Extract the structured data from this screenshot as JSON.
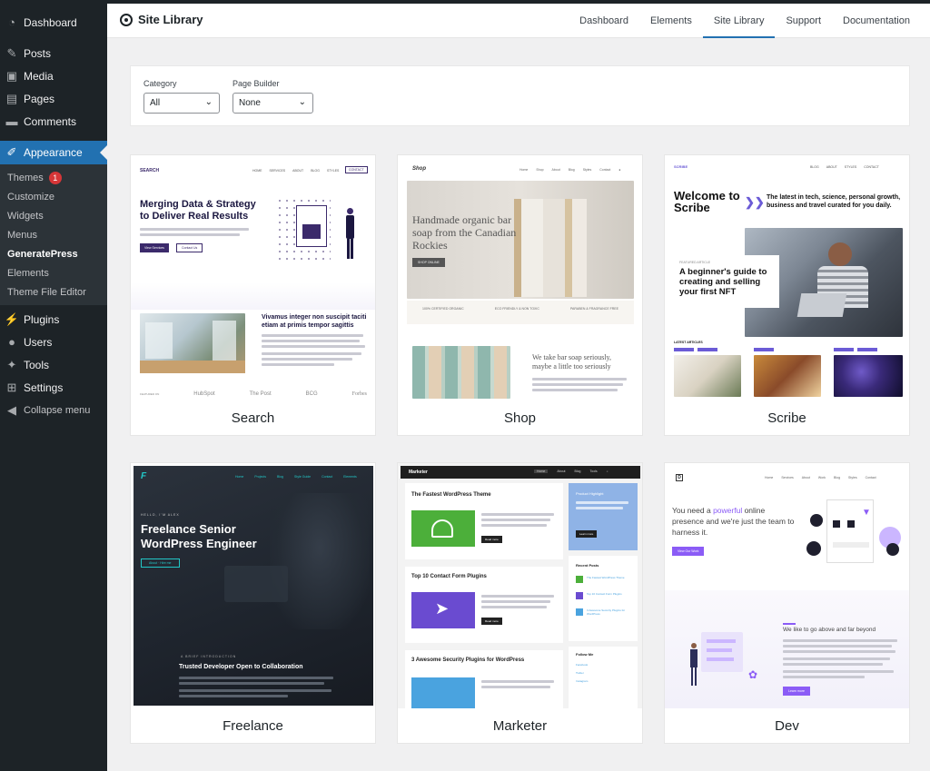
{
  "sidebar": {
    "dashboard": "Dashboard",
    "posts": "Posts",
    "media": "Media",
    "pages": "Pages",
    "comments": "Comments",
    "appearance": "Appearance",
    "submenu": {
      "themes": "Themes",
      "themes_badge": "1",
      "customize": "Customize",
      "widgets": "Widgets",
      "menus": "Menus",
      "generatepress": "GeneratePress",
      "elements": "Elements",
      "theme_file_editor": "Theme File Editor"
    },
    "plugins": "Plugins",
    "users": "Users",
    "tools": "Tools",
    "settings": "Settings",
    "collapse": "Collapse menu"
  },
  "header": {
    "title": "Site Library",
    "nav": [
      "Dashboard",
      "Elements",
      "Site Library",
      "Support",
      "Documentation"
    ]
  },
  "filters": {
    "category_label": "Category",
    "category_value": "All",
    "builder_label": "Page Builder",
    "builder_value": "None"
  },
  "previews": {
    "search": {
      "logo": "SEARCH",
      "nav": [
        "HOME",
        "SERVICES",
        "ABOUT",
        "BLOG",
        "STYLES"
      ],
      "cta": "CONTACT",
      "headline": "Merging Data & Strategy to Deliver Real Results",
      "btn1": "View Services",
      "btn2": "Contact Us",
      "sub": "Vivamus integer non suscipit taciti etiam at primis tempor sagittis",
      "logos": [
        "FEATURED ON",
        "HubSpot",
        "The Post",
        "BCG",
        "Forbes"
      ]
    },
    "shop": {
      "logo": "Shop",
      "nav": [
        "Home",
        "Shop",
        "About",
        "Blog",
        "Styles",
        "Contact"
      ],
      "headline": "Handmade organic bar soap from the Canadian Rockies",
      "btn": "SHOP ONLINE",
      "features": [
        "100% CERTIFIED ORGANIC",
        "ECO FRIENDLY & NON TOXIC",
        "PARABEN & FRAGRANCE FREE"
      ],
      "sub": "We take bar soap seriously, maybe a little too seriously"
    },
    "scribe": {
      "logo": "SCRIBE",
      "nav": [
        "BLOG",
        "ABOUT",
        "STYLES",
        "CONTACT"
      ],
      "headline": "Welcome to Scribe",
      "tagline": "The latest in tech, science, personal growth, business and travel curated for you daily.",
      "featured_label": "FEATURED ARTICLE",
      "featured": "A beginner's guide to creating and selling your first NFT",
      "latest_label": "LATEST ARTICLES"
    },
    "freelance": {
      "nav": [
        "Home",
        "Projects",
        "Blog",
        "Style Guide",
        "Contact",
        "Elements"
      ],
      "kicker": "HELLO, I'M ALEX",
      "headline": "Freelance Senior WordPress Engineer",
      "btn": "About · Hire me",
      "intro_label": "A BRIEF INTRODUCTION",
      "intro": "Trusted Developer Open to Collaboration"
    },
    "marketer": {
      "logo": "Marketer",
      "nav": [
        "Home",
        "About",
        "Blog",
        "Tools"
      ],
      "post1": "The Fastest WordPress Theme",
      "post2": "Top 10 Contact Form Plugins",
      "post3": "3 Awesome Security Plugins for WordPress",
      "btn": "Read more",
      "side_title": "Product Highlight",
      "side_btn": "Learn more",
      "recent": "Recent Posts",
      "recent_items": [
        "The Fastest WordPress Theme",
        "Top 10 Contact Form Plugins",
        "3 Awesome Security Plugins for WordPress"
      ],
      "follow": "Follow Me",
      "follow_items": [
        "Facebook",
        "Twitter",
        "Instagram"
      ]
    },
    "dev": {
      "logo": "D",
      "nav": [
        "Home",
        "Services",
        "About",
        "Work",
        "Blog",
        "Styles",
        "Contact"
      ],
      "headline_pre": "You need a ",
      "headline_accent": "powerful",
      "headline_post": " online presence and we're just the team to harness it.",
      "btn": "View Our Work",
      "sub": "We like to go above and far beyond",
      "btn2": "Learn more"
    }
  },
  "cards": [
    {
      "name": "Search"
    },
    {
      "name": "Shop"
    },
    {
      "name": "Scribe"
    },
    {
      "name": "Freelance"
    },
    {
      "name": "Marketer"
    },
    {
      "name": "Dev"
    }
  ],
  "colors": {
    "sidebar_bg": "#1d2327",
    "accent": "#2271b1",
    "search_purple": "#3b2a6b",
    "scribe_purple": "#6b5bd6",
    "marketer_green": "#4caf3a",
    "marketer_purple": "#6a4bd0",
    "marketer_blue": "#4aa3df",
    "freelance_bg": "#1f252e",
    "freelance_accent": "#22c7c7",
    "dev_purple": "#8b5cf6"
  }
}
